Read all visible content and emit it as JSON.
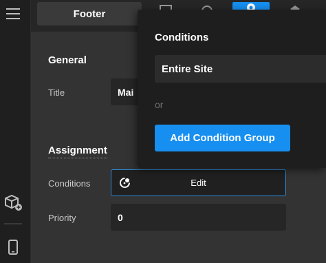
{
  "toolbar": {
    "active_tab": "Footer"
  },
  "general": {
    "heading": "General",
    "title_label": "Title",
    "title_value": "Mai"
  },
  "assignment": {
    "heading": "Assignment",
    "conditions_label": "Conditions",
    "edit_label": "Edit",
    "priority_label": "Priority",
    "priority_value": "0"
  },
  "conditions_popover": {
    "title": "Conditions",
    "items": [
      "Entire Site"
    ],
    "separator": "or",
    "add_button": "Add Condition Group"
  },
  "colors": {
    "accent": "#168ff0",
    "rail_bg": "#1f1f1f",
    "panel_bg": "#333333",
    "popover_bg": "#1e1e1e"
  },
  "icons": {
    "rail_top": "hamburger-menu-icon",
    "rail_middle": "add-components-icon",
    "rail_bottom": "mobile-device-icon",
    "edit": "conditions-edit-icon"
  }
}
